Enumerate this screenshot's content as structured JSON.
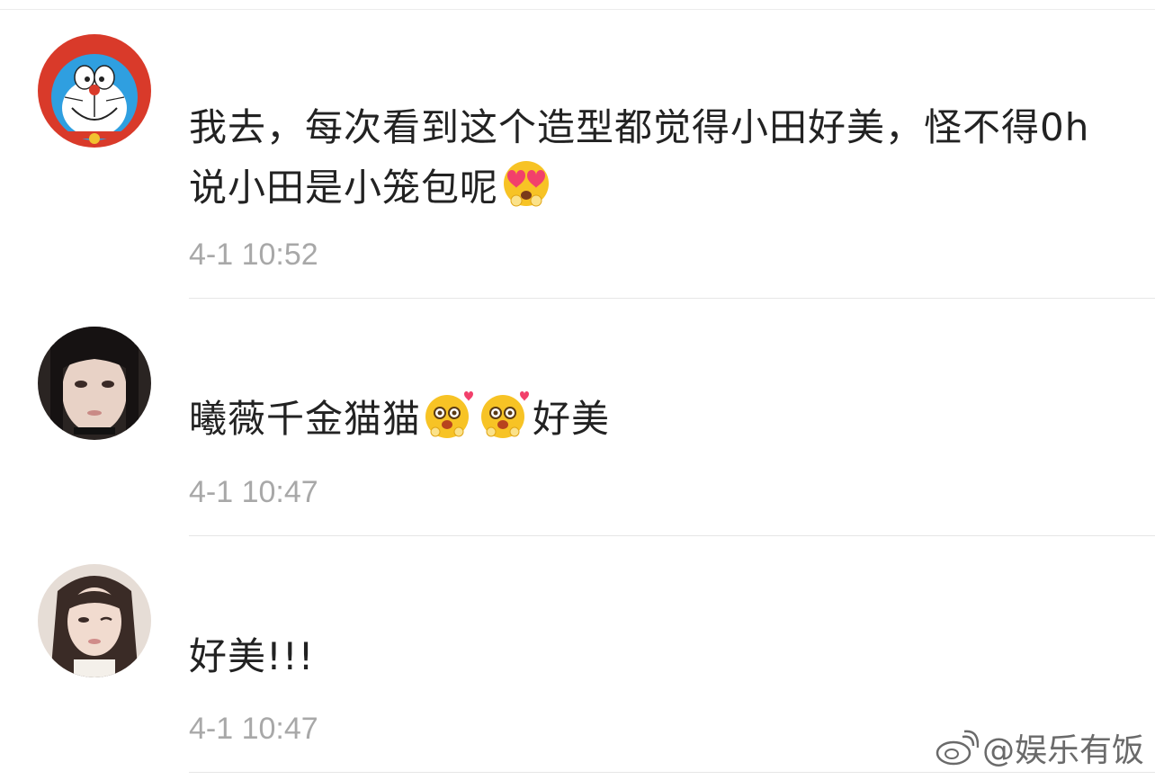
{
  "comments": [
    {
      "text_part1": "我去，每次看到这个造型都觉得小田好美，怪不得",
      "text_part2": "0h说小田是小笼包呢",
      "avatar_icon": "doraemon-avatar-icon",
      "emojis": [
        "heart-eyes-emoji-icon"
      ],
      "timestamp": "4-1 10:52"
    },
    {
      "text_part1": "曦薇千金猫猫",
      "text_part2": "好美",
      "avatar_icon": "user-photo-avatar-icon",
      "emojis": [
        "cute-face-emoji-icon",
        "cute-face-emoji-icon"
      ],
      "timestamp": "4-1 10:47"
    },
    {
      "text_part1": "好美!!!",
      "avatar_icon": "user-photo-avatar-icon",
      "emojis": [],
      "timestamp": "4-1 10:47"
    }
  ],
  "watermark": {
    "icon": "weibo-logo-icon",
    "label": "@娱乐有饭"
  },
  "colors": {
    "text": "#222222",
    "timestamp": "#a8a8a8",
    "divider": "#e6e6e6"
  }
}
